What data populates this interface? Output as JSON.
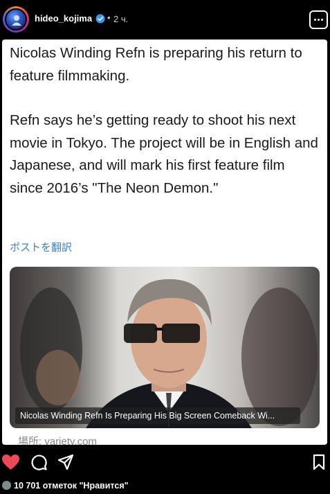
{
  "header": {
    "username": "hideo_kojima",
    "separator": "•",
    "time": "2 ч."
  },
  "post": {
    "paragraphs": [
      "Nicolas Winding Refn is preparing his return to feature filmmaking.",
      "Refn says he’s getting ready to shoot his next movie in Tokyo. The project will be in English and Japanese, and will mark his first feature film since 2016’s \"The Neon Demon.\""
    ],
    "translate_label": "ポストを翻訳"
  },
  "link_preview": {
    "caption": "Nicolas Winding Refn Is Preparing His Big Screen Comeback Wi...",
    "source": "場所: variety.com"
  },
  "footer": {
    "likes": "10 701 отметок \"Нравится\""
  },
  "colors": {
    "accent_link": "#3b82c6",
    "like_red": "#ed4956",
    "verified_blue": "#3897f0"
  },
  "icons": [
    "heart-icon",
    "comment-icon",
    "share-icon",
    "bookmark-icon",
    "more-icon",
    "verified-icon"
  ]
}
